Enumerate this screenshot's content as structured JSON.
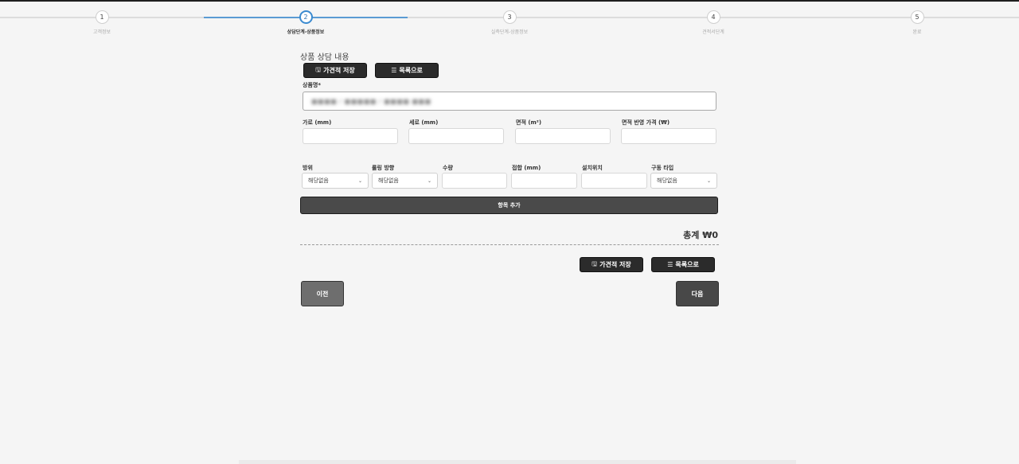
{
  "stepper": {
    "steps": [
      {
        "number": "1",
        "label": "고객정보"
      },
      {
        "number": "2",
        "label": "상담단계-상품정보"
      },
      {
        "number": "3",
        "label": "실측단계-상품정보"
      },
      {
        "number": "4",
        "label": "견적서단계"
      },
      {
        "number": "5",
        "label": "완료"
      }
    ],
    "active_step": 2
  },
  "section": {
    "title": "상품 상담 내용",
    "save_quote_label": "가견적 저장",
    "to_list_label": "목록으로"
  },
  "product": {
    "label": "상품명",
    "required_mark": "*",
    "value_blurred": "■■■■ / ■■■■■ / ■■■■ ■■■"
  },
  "dimensions": {
    "width_label": "가로 (mm)",
    "height_label": "세로 (mm)",
    "area_label": "면적 (m²)",
    "area_price_label": "면적 반영 가격 (₩)"
  },
  "options": {
    "direction_label": "방위",
    "direction_value": "해당없음",
    "rolling_label": "롤링 방향",
    "rolling_value": "해당없음",
    "quantity_label": "수량",
    "fold_label": "접합 (mm)",
    "install_label": "설치위치",
    "drive_label": "구동 타입",
    "drive_value": "해당없음"
  },
  "add_item_label": "항목 추가",
  "total_label": "총계 ₩0",
  "footer": {
    "save_quote_label": "가견적 저장",
    "to_list_label": "목록으로"
  },
  "nav": {
    "prev_label": "이전",
    "next_label": "다음"
  },
  "colors": {
    "active_step": "#3a8ad0",
    "button_dark": "#2b2b2b"
  }
}
